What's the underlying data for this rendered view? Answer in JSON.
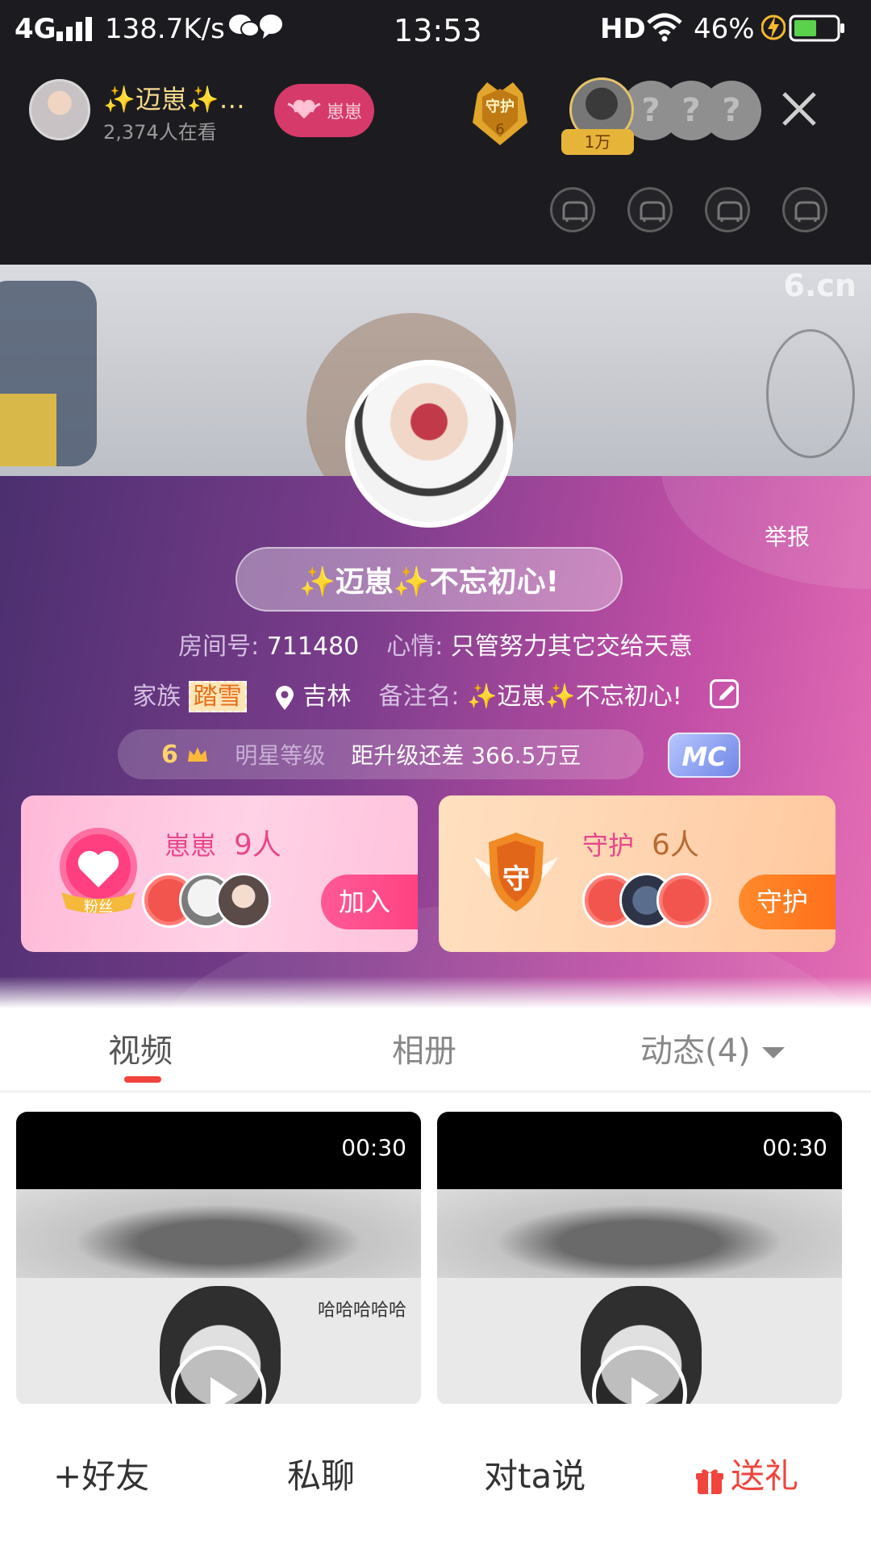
{
  "status_bar": {
    "network": "4G",
    "speed": "138.7K/s",
    "time": "13:53",
    "hd": "HD",
    "battery": "46%"
  },
  "live_header": {
    "host_name": "✨迈崽✨…",
    "viewers": "2,374人在看",
    "fan_club_label": "崽崽",
    "guard_label": "守护",
    "guard_count": "6",
    "top_fan_tag": "1万",
    "unknown_fan_mark": "?",
    "seat_count": 4
  },
  "cover": {
    "watermark": "6.cn"
  },
  "profile": {
    "report": "举报",
    "nickname": "✨迈崽✨不忘初心!",
    "room_label": "房间号:",
    "room_number": "711480",
    "mood_label": "心情:",
    "mood": "只管努力其它交给天意",
    "family_label": "家族",
    "family": "踏雪",
    "location": "吉林",
    "remark_label": "备注名:",
    "remark": "✨迈崽✨不忘初心!",
    "level": "6",
    "level_label": "明星等级",
    "upgrade_text": "距升级还差 366.5万豆",
    "mc_badge": "MC"
  },
  "fan_card": {
    "emblem_text": "粉丝",
    "title": "崽崽",
    "count": "9人",
    "button": "加入"
  },
  "guard_card": {
    "emblem_text": "守",
    "title": "守护",
    "count": "6人",
    "button": "守护"
  },
  "tabs": [
    {
      "label": "视频",
      "active": true
    },
    {
      "label": "相册",
      "active": false
    },
    {
      "label": "动态(4)",
      "active": false
    }
  ],
  "videos": [
    {
      "duration": "00:30",
      "caption": "哈哈哈哈哈"
    },
    {
      "duration": "00:30",
      "caption": ""
    }
  ],
  "actions": {
    "add_friend": "+好友",
    "private_chat": "私聊",
    "say_to": "对ta说",
    "gift": "送礼"
  },
  "colors": {
    "accent_red": "#f0443c",
    "panel_purple": "#7c3d8c",
    "panel_pink": "#e66fb5",
    "gold": "#f4d98c"
  }
}
